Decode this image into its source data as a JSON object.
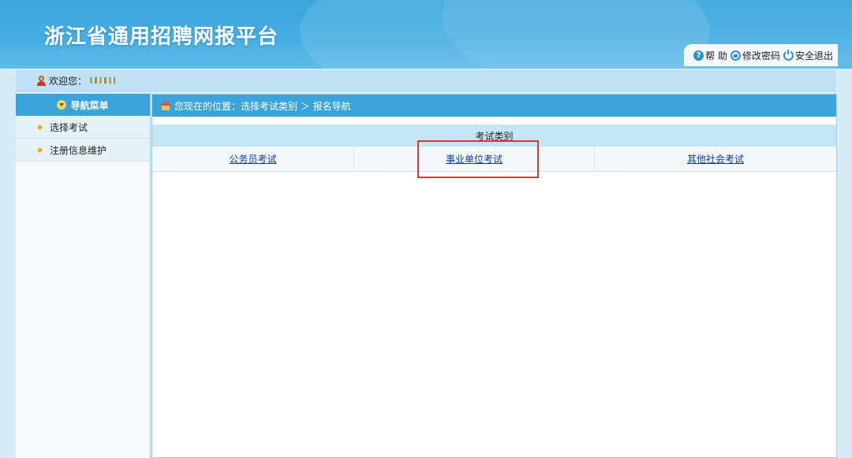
{
  "header": {
    "title": "浙江省通用招聘网报平台",
    "links": {
      "help": "帮 助",
      "change_password": "修改密码",
      "logout": "安全退出"
    }
  },
  "welcome": {
    "label": "欢迎您："
  },
  "sidebar": {
    "title": "导航菜单",
    "items": [
      {
        "label": "选择考试"
      },
      {
        "label": "注册信息维护"
      }
    ]
  },
  "breadcrumb": {
    "text": "您现在的位置：选择考试类别 ＞ 报名导航"
  },
  "exam_categories": {
    "header": "考试类别",
    "items": [
      {
        "label": "公务员考试"
      },
      {
        "label": "事业单位考试"
      },
      {
        "label": "其他社会考试"
      }
    ]
  },
  "colors": {
    "header_blue": "#3aa6dc",
    "highlight_red": "#e53430",
    "link_blue": "#0b3aa6"
  }
}
